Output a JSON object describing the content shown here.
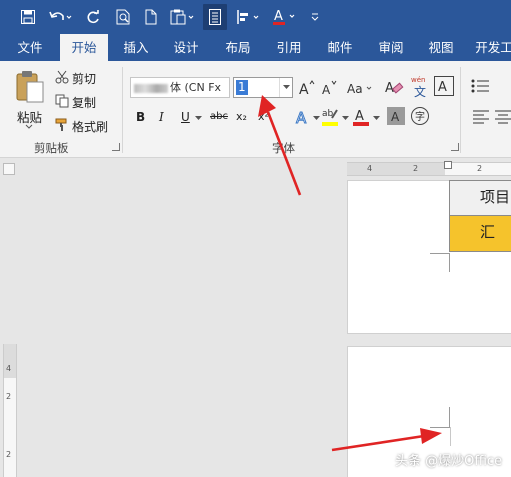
{
  "tabs": [
    {
      "id": "file",
      "label": "文件"
    },
    {
      "id": "home",
      "label": "开始",
      "selected": true
    },
    {
      "id": "insert",
      "label": "插入"
    },
    {
      "id": "design",
      "label": "设计"
    },
    {
      "id": "layout",
      "label": "布局"
    },
    {
      "id": "references",
      "label": "引用"
    },
    {
      "id": "mailings",
      "label": "邮件"
    },
    {
      "id": "review",
      "label": "审阅"
    },
    {
      "id": "view",
      "label": "视图"
    },
    {
      "id": "developer",
      "label": "开发工"
    }
  ],
  "clipboard": {
    "paste_label": "粘贴",
    "cut_label": "剪切",
    "copy_label": "复制",
    "format_painter_label": "格式刷",
    "group_label": "剪贴板"
  },
  "font": {
    "font_name": "体 (CN Fx",
    "font_size": "1",
    "group_label": "字体",
    "phonetic_glyph": "wén",
    "phonetic_sub": "文",
    "case_label": "Aa",
    "grow_label": "A",
    "shrink_label": "A",
    "bold": "B",
    "italic": "I",
    "underline": "U",
    "strike": "abc",
    "subscript": "x₂",
    "superscript": "x²",
    "enclose": "字",
    "highlight_label": "ab",
    "font_color_label": "A",
    "char_shading_label": "A"
  },
  "document": {
    "cell_header": "项目",
    "cell_summary": "汇",
    "summary_fill": "#f5c32c"
  },
  "ruler": {
    "h_numbers": [
      "4",
      "2",
      "2"
    ],
    "v_numbers": [
      "4",
      "2",
      "2"
    ]
  },
  "watermark": "头条 @爆炒Office",
  "colors": {
    "brand": "#2b579a",
    "arrow": "#e02424",
    "font_color_bar": "#e02424",
    "highlight_bar": "#ffff00"
  }
}
